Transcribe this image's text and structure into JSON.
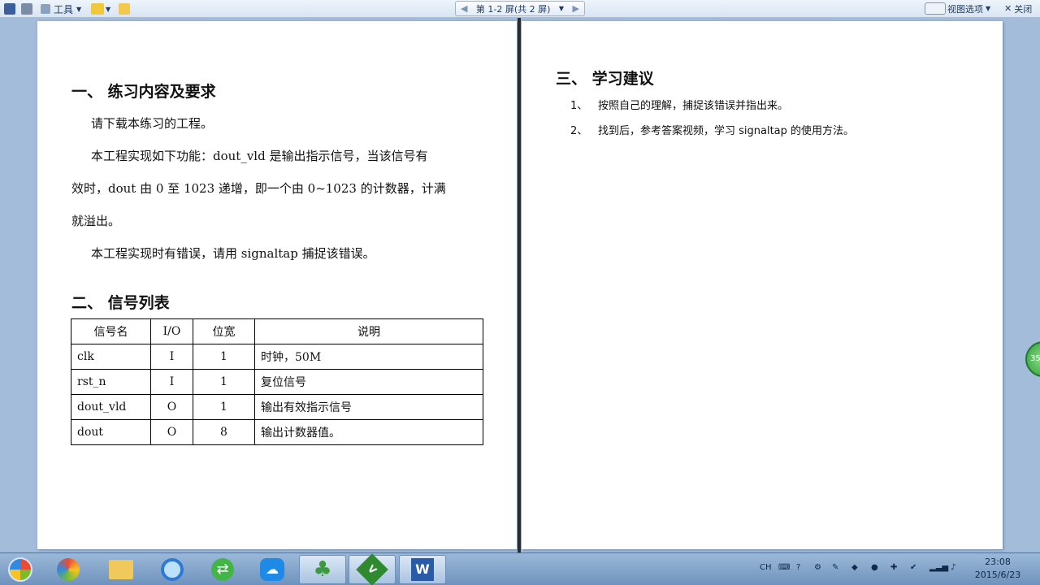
{
  "toolbar": {
    "tools_label": "工具",
    "pager_label": "第 1-2 屏(共 2 屏)",
    "view_options_label": "视图选项",
    "close_label": "关闭"
  },
  "doc_left": {
    "heading1": "一、 练习内容及要求",
    "p1": "请下载本练习的工程。",
    "p2_line1": "本工程实现如下功能：dout_vld 是输出指示信号，当该信号有",
    "p2_line2": "效时，dout 由 0 至 1023 递增，即一个由 0~1023 的计数器，计满",
    "p2_line3": "就溢出。",
    "p3": "本工程实现时有错误，请用 signaltap 捕捉该错误。",
    "heading2": "二、 信号列表",
    "table": {
      "headers": [
        "信号名",
        "I/O",
        "位宽",
        "说明"
      ],
      "rows": [
        [
          "clk",
          "I",
          "1",
          "时钟，50M"
        ],
        [
          "rst_n",
          "I",
          "1",
          "复位信号"
        ],
        [
          "dout_vld",
          "O",
          "1",
          "输出有效指示信号"
        ],
        [
          "dout",
          "O",
          "8",
          "输出计数器值。"
        ]
      ]
    }
  },
  "doc_right": {
    "heading3": "三、 学习建议",
    "items": [
      {
        "num": "1、",
        "text": "按照自己的理解，捕捉该错误并指出来。"
      },
      {
        "num": "2、",
        "text": "找到后，参考答案视频，学习 signaltap 的使用方法。"
      }
    ]
  },
  "overlay": {
    "circle_text": "35"
  },
  "taskbar": {
    "lang": "CH",
    "time": "23:08",
    "date": "2015/6/23"
  }
}
